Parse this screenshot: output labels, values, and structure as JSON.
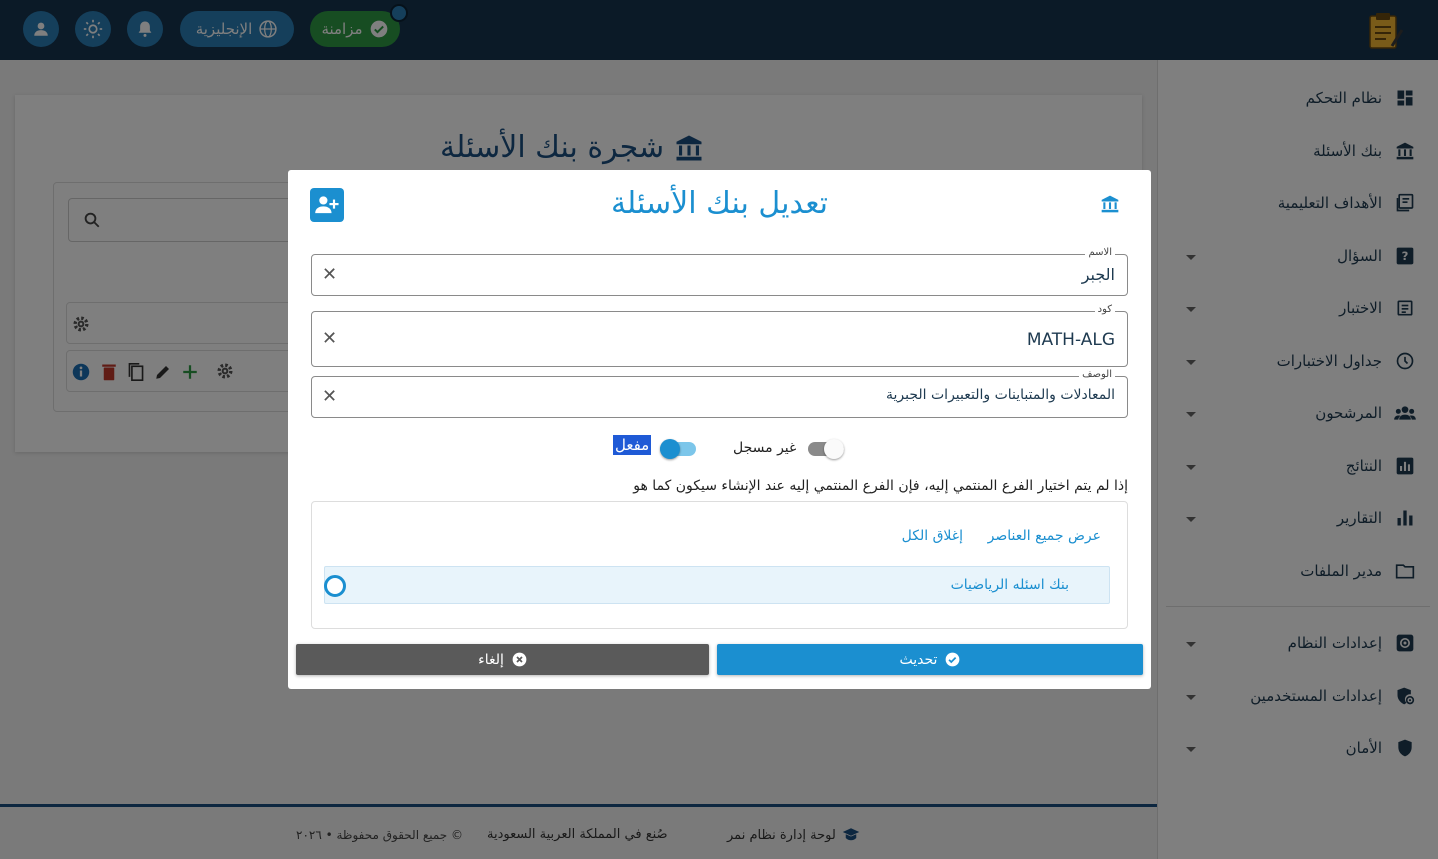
{
  "topbar": {
    "sync_label": "مزامنة",
    "language_label": "الإنجليزية",
    "icons": [
      "user-icon",
      "sun-icon",
      "bell-icon",
      "globe-icon",
      "check-circle-icon"
    ]
  },
  "background": {
    "page_title": "شجرة بنك الأسئلة"
  },
  "sidebar": {
    "items": [
      {
        "label": "نظام التحكم",
        "icon": "dashboard-icon",
        "expandable": false
      },
      {
        "label": "بنك الأسئلة",
        "icon": "bank-icon",
        "expandable": false
      },
      {
        "label": "الأهداف التعليمية",
        "icon": "book-icon",
        "expandable": false
      },
      {
        "label": "السؤال",
        "icon": "question-icon",
        "expandable": true
      },
      {
        "label": "الاختبار",
        "icon": "exam-icon",
        "expandable": true
      },
      {
        "label": "جداول الاختبارات",
        "icon": "clock-icon",
        "expandable": true
      },
      {
        "label": "المرشحون",
        "icon": "people-icon",
        "expandable": true
      },
      {
        "label": "النتائج",
        "icon": "chart-icon",
        "expandable": true
      },
      {
        "label": "التقارير",
        "icon": "bar-chart-icon",
        "expandable": true
      },
      {
        "label": "مدير الملفات",
        "icon": "folder-icon",
        "expandable": false
      },
      {
        "label": "إعدادات النظام",
        "icon": "settings-icon",
        "expandable": true
      },
      {
        "label": "إعدادات المستخدمين",
        "icon": "user-shield-icon",
        "expandable": true
      },
      {
        "label": "الأمان",
        "icon": "shield-icon",
        "expandable": true
      }
    ]
  },
  "modal": {
    "title": "تعديل بنك الأسئلة",
    "fields": {
      "name": {
        "label": "الاسم",
        "value": "الجبر"
      },
      "code": {
        "label": "كود",
        "value": "MATH-ALG"
      },
      "description": {
        "label": "الوصف",
        "value": "المعادلات والمتباينات والتعبيرات الجبرية"
      }
    },
    "toggles": {
      "registered": {
        "label": "غير مسجل",
        "on": false
      },
      "active": {
        "label": "مفعل",
        "on": true
      }
    },
    "note": "إذا لم يتم اختيار الفرع المنتمي إليه، فإن الفرع المنتمي إليه عند الإنشاء سيكون كما هو",
    "tree": {
      "show_all": "عرض جميع العناصر",
      "close_all": "إغلاق الكل",
      "items": [
        {
          "label": "بنك اسئله الرياضيات"
        }
      ]
    },
    "update_label": "تحديث",
    "cancel_label": "إلغاء"
  },
  "footer": {
    "brand": "لوحة إدارة نظام نمر",
    "made_in": "صُنع في المملكة العربية السعودية",
    "copyright": "جميع الحقوق محفوظة • ٢٠٢٦ ©"
  },
  "colors": {
    "primary": "#1b8fd0",
    "topbar": "#16344f",
    "sync": "#2e9a44",
    "cancel": "#5a5a5a"
  }
}
